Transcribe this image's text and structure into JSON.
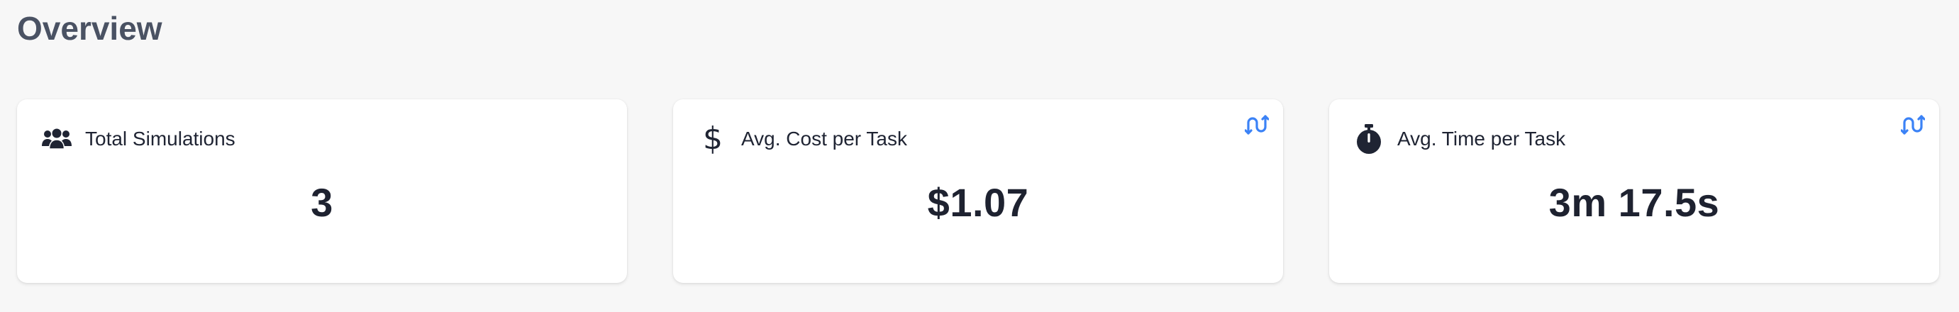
{
  "overview": {
    "title": "Overview"
  },
  "cards": [
    {
      "label": "Total Simulations",
      "value": "3",
      "icon": "users-group-icon",
      "has_toggle": false
    },
    {
      "label": "Avg. Cost per Task",
      "value": "$1.07",
      "icon": "dollar-icon",
      "icon_glyph": "$",
      "has_toggle": true,
      "toggle_icon": "swap-vertical-icon"
    },
    {
      "label": "Avg. Time per Task",
      "value": "3m 17.5s",
      "icon": "stopwatch-icon",
      "has_toggle": true,
      "toggle_icon": "swap-vertical-icon"
    }
  ],
  "colors": {
    "background": "#f7f7f7",
    "card_background": "#ffffff",
    "title_text": "#4a5263",
    "body_text": "#1f2433",
    "accent": "#3b82f6"
  }
}
